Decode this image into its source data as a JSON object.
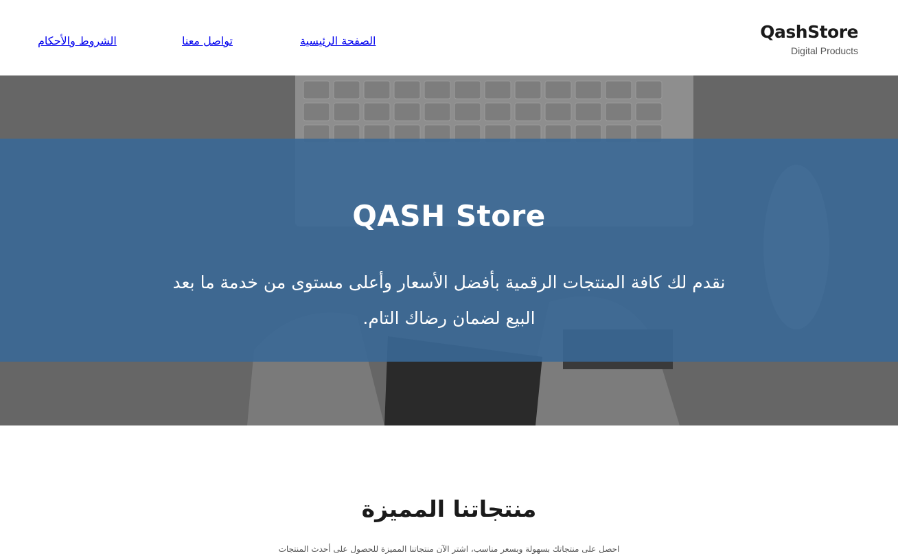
{
  "header": {
    "brand": {
      "name": "QashStore",
      "tagline": "Digital Products"
    },
    "nav": {
      "home": "الصفحة الرئيسية",
      "contact": "تواصل معنا",
      "terms": "الشروط والأحكام"
    }
  },
  "hero": {
    "title": "QASH Store",
    "text": "نقدم لك كافة المنتجات الرقمية بأفضل الأسعار وأعلى مستوى من خدمة ما بعد البيع لضمان رضاك التام."
  },
  "featured": {
    "title": "منتجاتنا المميزة",
    "subtitle": "احصل على منتجاتك بسهولة وبسعر مناسب، اشتر الآن منتجاتنا المميزة للحصول على أحدث المنتجات"
  },
  "colors": {
    "band": "#3a6896",
    "text_dark": "#1a1a1a"
  }
}
